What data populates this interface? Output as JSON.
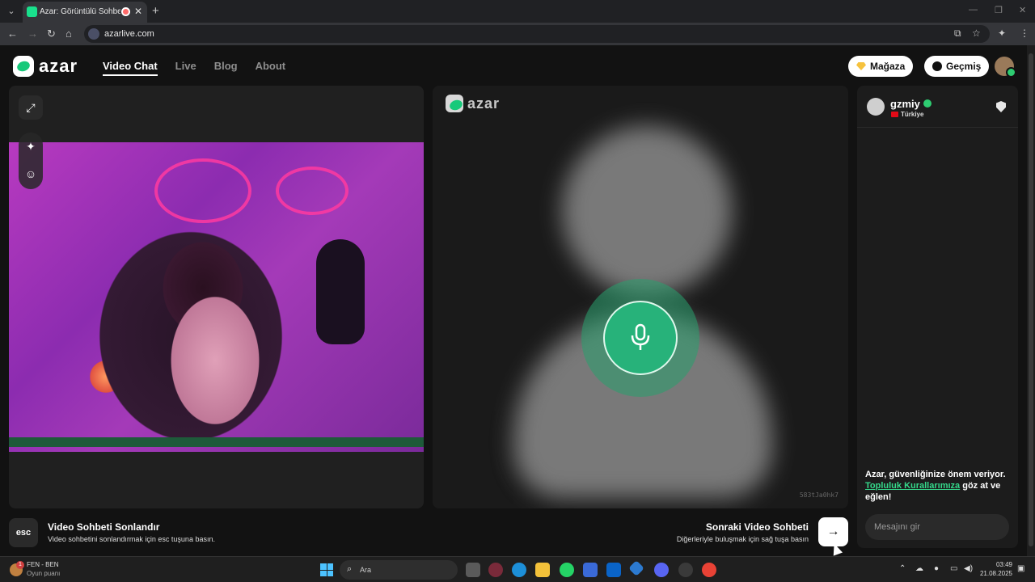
{
  "browser": {
    "tab_title": "Azar: Görüntülü Sohbet, Ar",
    "url": "azarlive.com"
  },
  "header": {
    "logo_text": "azar",
    "nav": [
      "Video Chat",
      "Live",
      "Blog",
      "About"
    ],
    "active_nav": "Video Chat",
    "store_label": "Mağaza",
    "history_label": "Geçmiş"
  },
  "center": {
    "logo_text": "azar",
    "session_id": "583tJa0hk7"
  },
  "bottom": {
    "esc_key": "esc",
    "end_title": "Video Sohbeti Sonlandır",
    "end_desc": "Video sohbetini sonlandırmak için esc tuşuna basın.",
    "next_title": "Sonraki Video Sohbeti",
    "next_desc": "Diğerleriyle buluşmak için sağ tuşa basın",
    "next_icon": "arrow-right-icon"
  },
  "chat": {
    "peer_name": "gzmiy",
    "peer_country": "Türkiye",
    "safety_text_a": "Azar, güvenliğinize önem veriyor.",
    "safety_link": "Topluluk Kurallarımıza",
    "safety_text_b": "göz at ve eğlen!",
    "input_placeholder": "Mesajını gir"
  },
  "taskbar": {
    "weather_a": "FEN - BEN",
    "weather_b": "Oyun puanı",
    "weather_badge": "1",
    "search": "Ara",
    "time": "03:49",
    "date": "21.08.2025"
  },
  "colors": {
    "brand_green": "#17c97a",
    "link_green": "#35d98b",
    "background": "#121212"
  }
}
